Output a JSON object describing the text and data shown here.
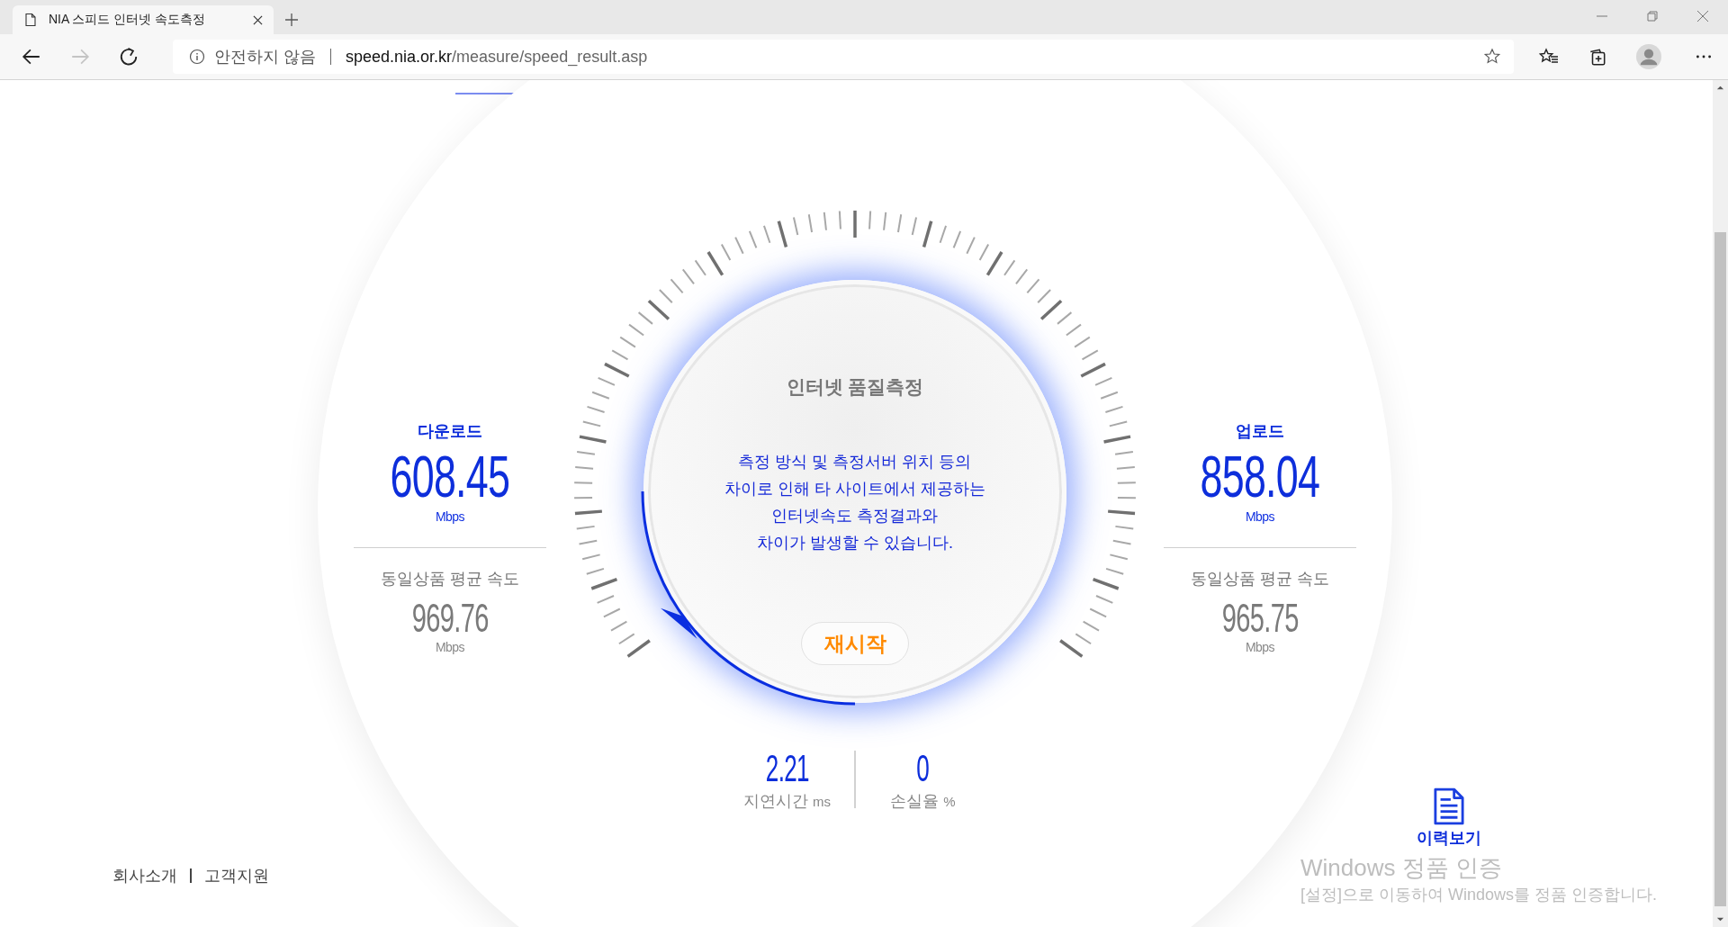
{
  "browser": {
    "tab_title": "NIA 스피드 인터넷 속도측정",
    "security_label": "안전하지 않음",
    "url_host": "speed.nia.or.kr",
    "url_path": "/measure/speed_result.asp"
  },
  "download": {
    "label": "다운로드",
    "value": "608.45",
    "unit": "Mbps",
    "avg_label": "동일상품 평균 속도",
    "avg_value": "969.76",
    "avg_unit": "Mbps"
  },
  "upload": {
    "label": "업로드",
    "value": "858.04",
    "unit": "Mbps",
    "avg_label": "동일상품 평균 속도",
    "avg_value": "965.75",
    "avg_unit": "Mbps"
  },
  "dial": {
    "title": "인터넷 품질측정",
    "notice": [
      "측정 방식 및 측정서버 위치 등의",
      "차이로 인해 타 사이트에서 제공하는",
      "인터넷속도 측정결과와",
      "차이가 발생할 수 있습니다."
    ],
    "restart_button": "재시작"
  },
  "metrics": [
    {
      "value": "2.21",
      "label": "지연시간",
      "unit": "ms"
    },
    {
      "value": "0",
      "label": "손실율",
      "unit": "%"
    }
  ],
  "footer_links": [
    "회사소개",
    "고객지원"
  ],
  "history_button": "이력보기",
  "windows_notice": {
    "title": "Windows 정품 인증",
    "message": "[설정]으로 이동하여 Windows를 정품 인증합니다."
  }
}
